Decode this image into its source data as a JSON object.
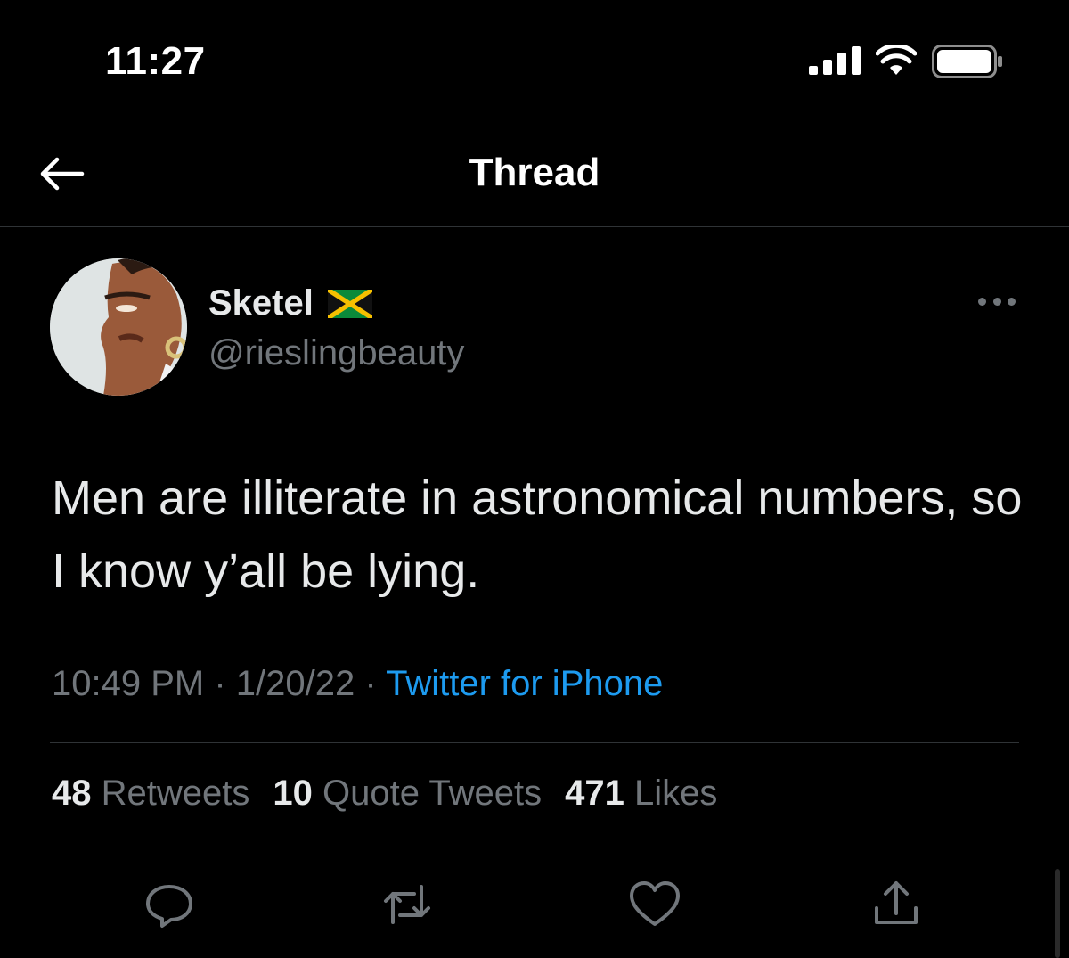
{
  "status_bar": {
    "time": "11:27",
    "icons": [
      "signal-icon",
      "wifi-icon",
      "battery-icon"
    ]
  },
  "header": {
    "title": "Thread",
    "back_icon": "arrow-left-icon"
  },
  "tweet": {
    "display_name": "Sketel",
    "name_flag": "jamaica-flag-icon",
    "handle": "@rieslingbeauty",
    "text": "Men are illiterate in astronomical numbers, so I know y’all be lying.",
    "time": "10:49 PM",
    "separator": "·",
    "date": "1/20/22",
    "source": "Twitter for iPhone",
    "stats": {
      "retweets_count": "48",
      "retweets_label": "Retweets",
      "quotes_count": "10",
      "quotes_label": "Quote Tweets",
      "likes_count": "471",
      "likes_label": "Likes"
    },
    "actions": [
      "reply-icon",
      "retweet-icon",
      "like-icon",
      "share-icon"
    ]
  },
  "colors": {
    "background": "#000000",
    "text_primary": "#e7e9ea",
    "text_secondary": "#71767b",
    "accent": "#1d9bf0",
    "divider": "#2f3336"
  }
}
